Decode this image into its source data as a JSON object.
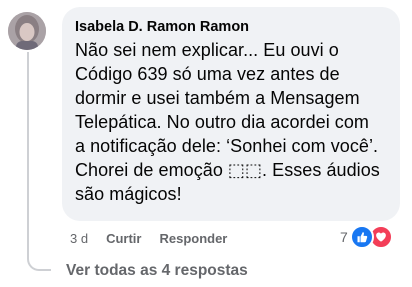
{
  "comment": {
    "author": "Isabela D. Ramon Ramon",
    "text": "Não sei nem explicar... Eu ouvi o\nCódigo 639 só uma vez antes de\ndormir e usei também a Mensagem\nTelepática. No outro dia acordei com\na notificação dele: ‘Sonhei com você’.\nChorei de emoção ⬚⬚. Esses áudios\nsão mágicos!",
    "time": "3 d",
    "like_label": "Curtir",
    "reply_label": "Responder",
    "reaction_count": "7",
    "reactions": [
      "like-icon",
      "love-icon"
    ]
  },
  "replies": {
    "view_label": "Ver todas as 4 respostas"
  },
  "colors": {
    "bubble": "#f0f2f5",
    "secondary_text": "#65676b",
    "like_blue": "#1877f2",
    "love_red": "#f33e58",
    "thread_line": "#ced0d4"
  }
}
